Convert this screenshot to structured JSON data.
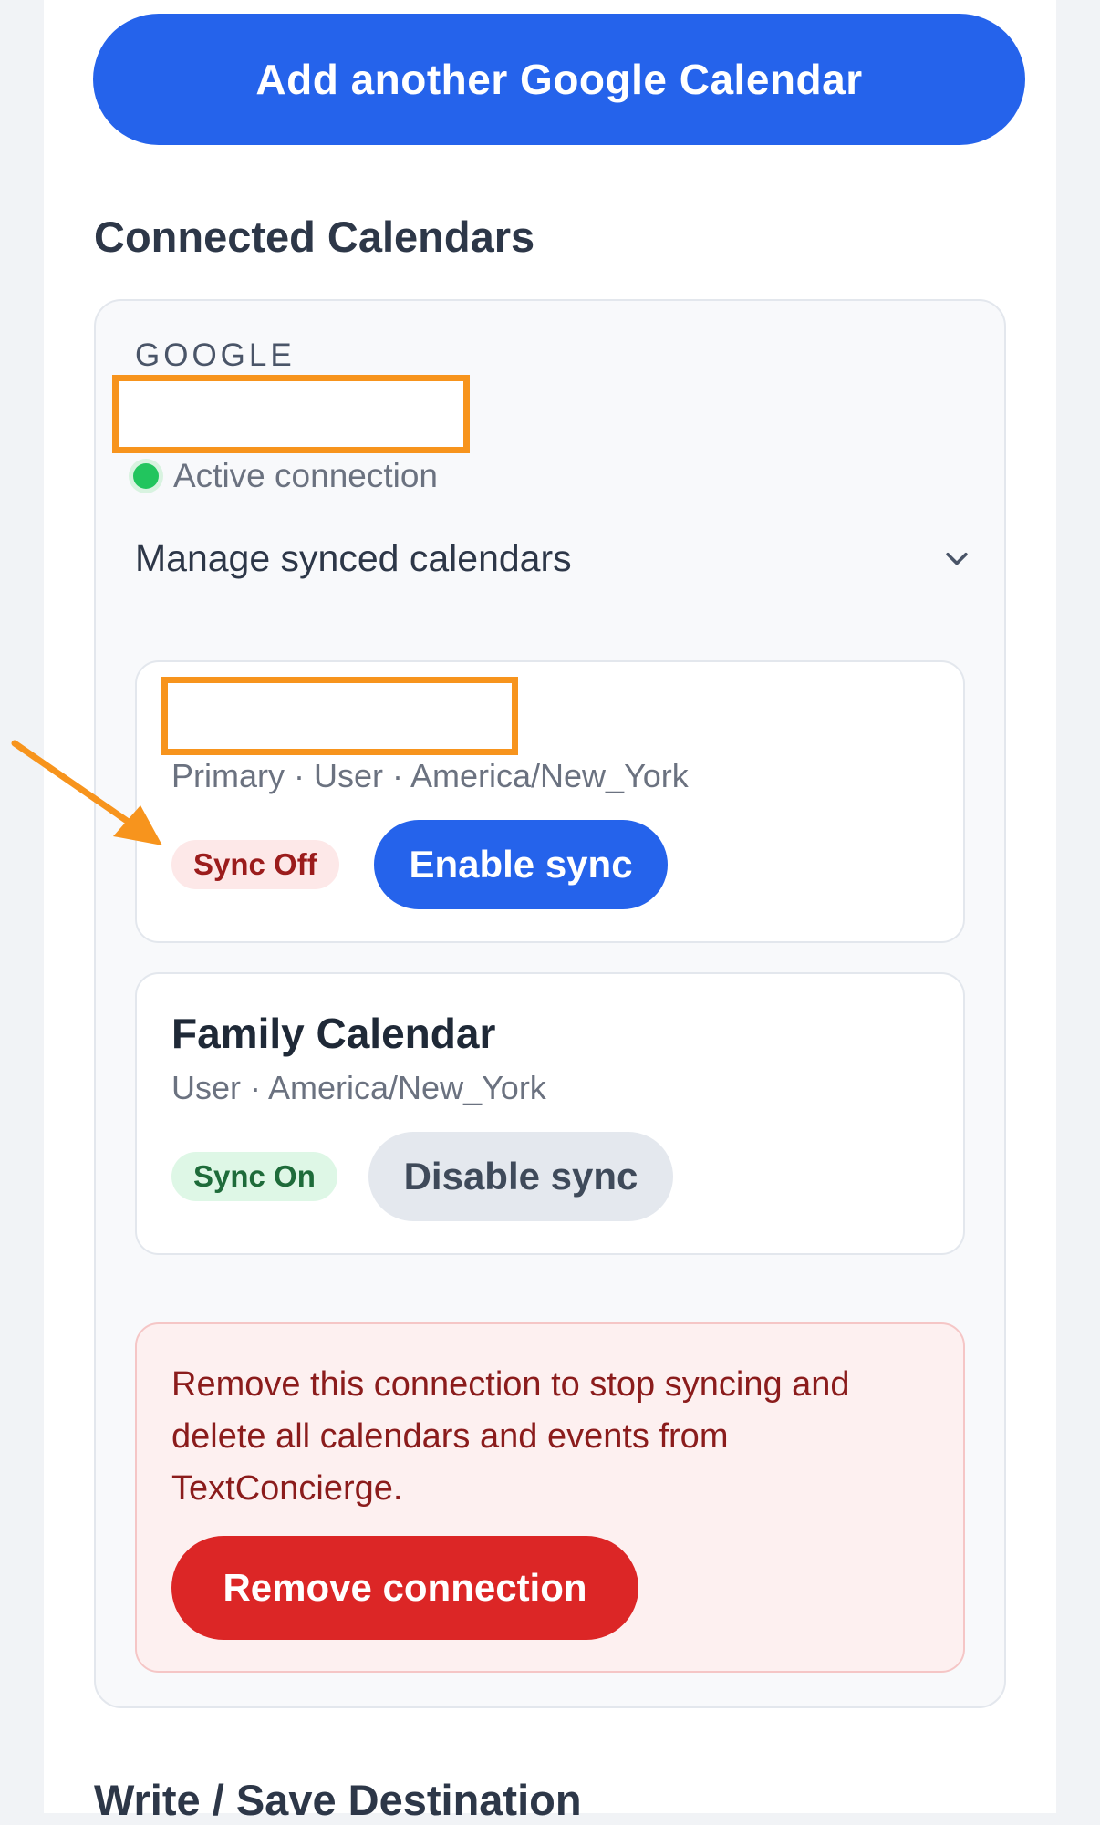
{
  "header": {
    "add_button_label": "Add another Google Calendar"
  },
  "connected": {
    "title": "Connected Calendars",
    "provider": "GOOGLE",
    "status_text": "Active connection",
    "status_color": "#22c55e",
    "manage_label": "Manage synced calendars"
  },
  "calendars": [
    {
      "subtitle": "Primary · User · America/New_York",
      "badge": "Sync Off",
      "action_label": "Enable sync"
    },
    {
      "title": "Family Calendar",
      "subtitle": "User · America/New_York",
      "badge": "Sync On",
      "action_label": "Disable sync"
    }
  ],
  "danger": {
    "message": "Remove this connection to stop syncing and delete all calendars and events from TextConcierge.",
    "button_label": "Remove connection"
  },
  "next_section": {
    "title": "Write / Save Destination"
  },
  "colors": {
    "primary": "#2563eb",
    "danger": "#dc2626",
    "annotation": "#f7941d"
  },
  "icons": {
    "manage_toggle": "chevron-down-icon",
    "annotation": "arrow-icon"
  }
}
